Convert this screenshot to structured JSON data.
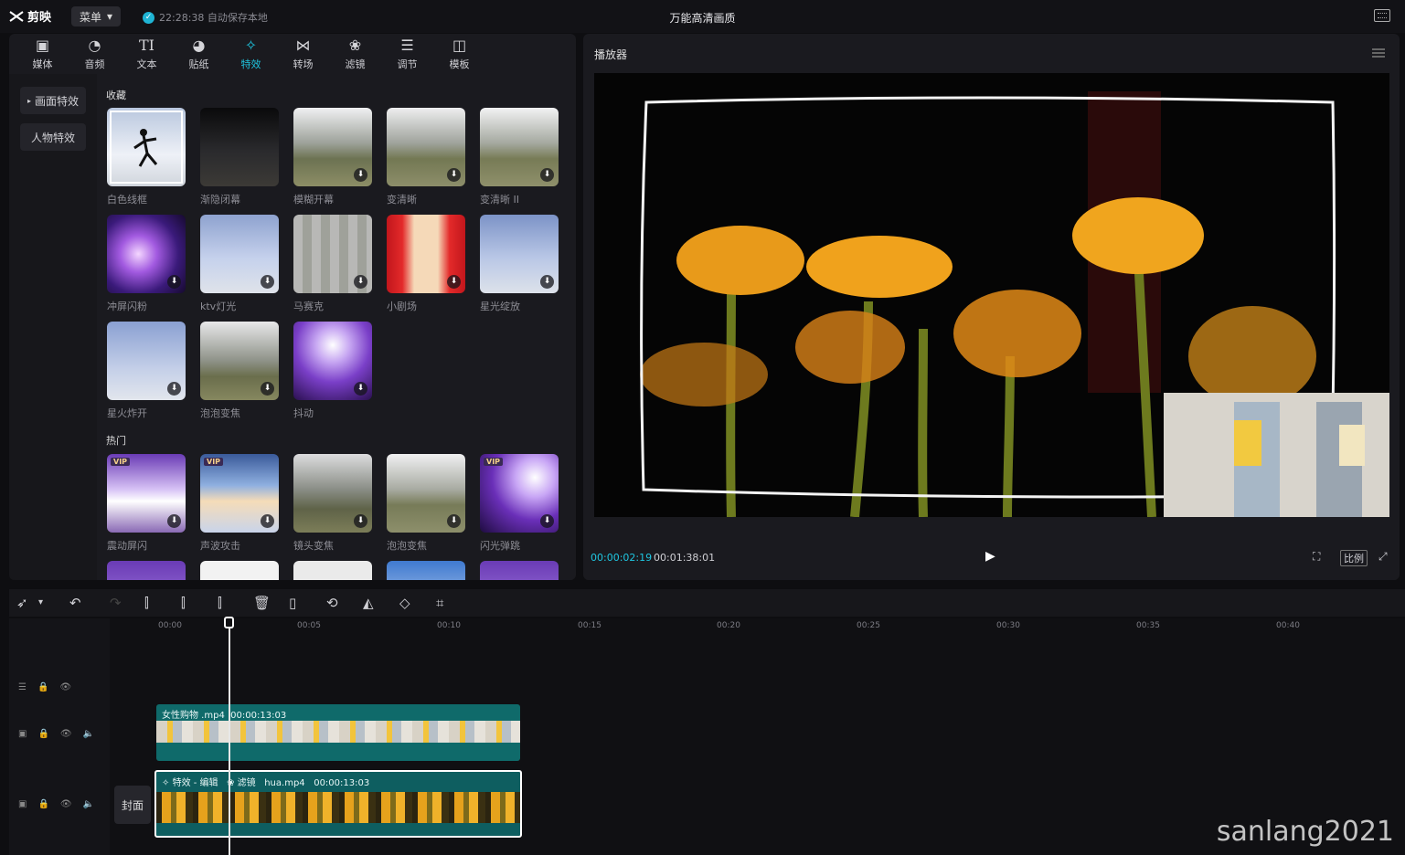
{
  "app": {
    "logo_text": "剪映",
    "menu_label": "菜单",
    "autosave_text": "22:28:38 自动保存本地",
    "project_title": "万能高清画质"
  },
  "tabs": [
    {
      "label": "媒体",
      "icon": "media-icon"
    },
    {
      "label": "音频",
      "icon": "audio-icon"
    },
    {
      "label": "文本",
      "icon": "text-icon"
    },
    {
      "label": "贴纸",
      "icon": "sticker-icon"
    },
    {
      "label": "特效",
      "icon": "effects-icon",
      "active": true
    },
    {
      "label": "转场",
      "icon": "transition-icon"
    },
    {
      "label": "滤镜",
      "icon": "filter-icon"
    },
    {
      "label": "调节",
      "icon": "adjust-icon"
    },
    {
      "label": "模板",
      "icon": "template-icon"
    }
  ],
  "side": {
    "item1": "画面特效",
    "item2": "人物特效"
  },
  "sections": {
    "favorites": "收藏",
    "hot": "热门"
  },
  "favorites": [
    {
      "label": "白色线框"
    },
    {
      "label": "渐隐闭幕"
    },
    {
      "label": "模糊开幕"
    },
    {
      "label": "变清晰"
    },
    {
      "label": "变清晰 II"
    },
    {
      "label": "冲屏闪粉"
    },
    {
      "label": "ktv灯光"
    },
    {
      "label": "马赛克"
    },
    {
      "label": "小剧场"
    },
    {
      "label": "星光绽放"
    },
    {
      "label": "星火炸开"
    },
    {
      "label": "泡泡变焦"
    },
    {
      "label": "抖动"
    }
  ],
  "hot": [
    {
      "label": "震动屏闪",
      "vip": "VIP"
    },
    {
      "label": "声波攻击",
      "vip": "VIP"
    },
    {
      "label": "镜头变焦"
    },
    {
      "label": "泡泡变焦"
    },
    {
      "label": "闪光弹跳",
      "vip": "VIP"
    }
  ],
  "player": {
    "title": "播放器",
    "time_current": "00:00:02:19",
    "time_total": "00:01:38:01",
    "ratio_label": "比例"
  },
  "timeline": {
    "ticks": [
      "00:00",
      "00:05",
      "00:10",
      "00:15",
      "00:20",
      "00:25",
      "00:30",
      "00:35",
      "00:40"
    ],
    "cover_label": "封面",
    "clip1": {
      "name": "女性购物 .mp4",
      "duration": "00:00:13:03"
    },
    "clip2": {
      "effect": "特效 - 编辑",
      "filter": "滤镜",
      "name": "hua.mp4",
      "duration": "00:00:13:03"
    }
  },
  "watermark": "sanlang2021",
  "colors": {
    "accent": "#1fc6e0",
    "clip": "#0f6a6a",
    "background": "#0e0e11"
  }
}
